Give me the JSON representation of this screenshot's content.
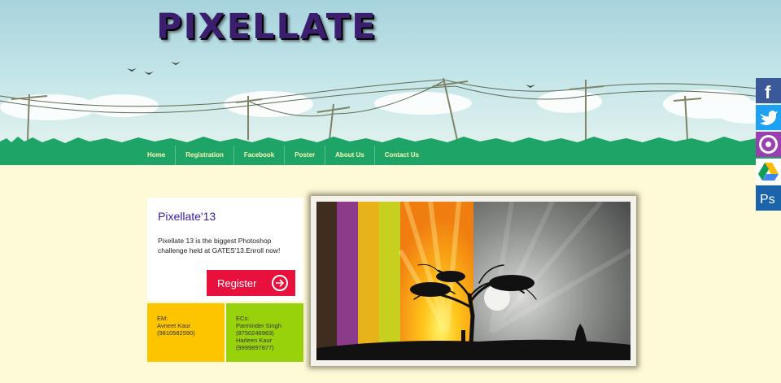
{
  "site": {
    "logo_text": "PIXELLATE"
  },
  "nav": {
    "items": [
      {
        "label": "Home"
      },
      {
        "label": "Registration"
      },
      {
        "label": "Facebook"
      },
      {
        "label": "Poster"
      },
      {
        "label": "About Us"
      },
      {
        "label": "Contact Us"
      }
    ]
  },
  "card": {
    "title": "Pixellate'13",
    "description": "Pixellate 13 is the biggest Photoshop challenge held at GATES'13.Enroll now!",
    "register_label": "Register"
  },
  "em": {
    "heading": "EM:",
    "name": "Avneet Kaur",
    "phone": "(9810582590)"
  },
  "ecs": {
    "heading": "ECs:",
    "people": [
      {
        "name": "Parminder Singh",
        "phone": "(8750246963)"
      },
      {
        "name": "Harleen Kaur",
        "phone": "(9999897877)"
      }
    ]
  },
  "social": [
    {
      "icon": "facebook-icon",
      "label": "f",
      "color": "#3b5998"
    },
    {
      "icon": "twitter-icon",
      "label": "",
      "color": "#1da1f2"
    },
    {
      "icon": "picasa-icon",
      "label": "",
      "color": "#9b3fb0"
    },
    {
      "icon": "google-drive-icon",
      "label": "",
      "color": "#ffffff"
    },
    {
      "icon": "photoshop-icon",
      "label": "Ps",
      "color": "#1b64ac"
    }
  ],
  "colors": {
    "background": "#fef9d6",
    "nav_green": "#1fa468",
    "register_red": "#e8103c",
    "em_yellow": "#fdc400",
    "ec_green": "#98d20b",
    "title_purple": "#3b1aa0"
  }
}
